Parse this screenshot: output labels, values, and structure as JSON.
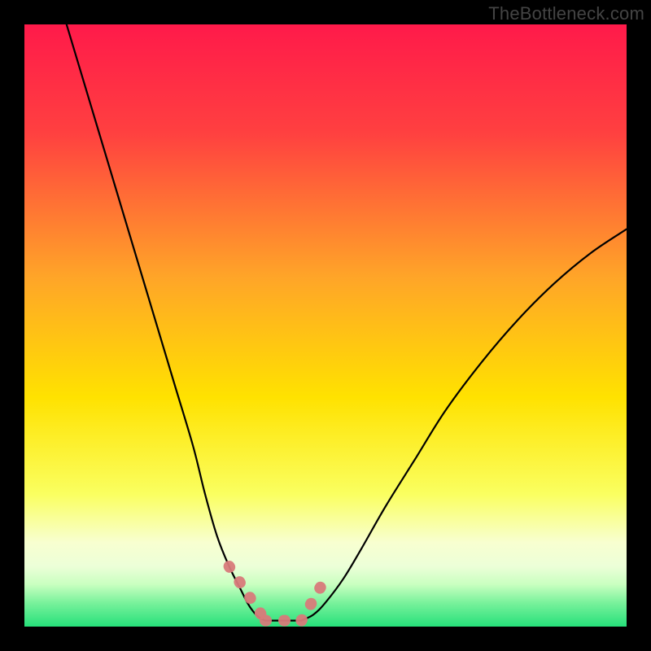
{
  "watermark": "TheBottleneck.com",
  "chart_data": {
    "type": "line",
    "title": "",
    "xlabel": "",
    "ylabel": "",
    "xlim": [
      0,
      100
    ],
    "ylim": [
      0,
      100
    ],
    "background_gradient": {
      "top_color": "#ff1a4a",
      "mid_color": "#ffe200",
      "bottom_band_color": "#f8ffd0",
      "base_color": "#26e07a"
    },
    "series": [
      {
        "name": "left-curve",
        "stroke": "#000000",
        "x": [
          7,
          10,
          13,
          16,
          19,
          22,
          25,
          28,
          30,
          32,
          34,
          36,
          37,
          38,
          39,
          40
        ],
        "y": [
          100,
          90,
          80,
          70,
          60,
          50,
          40,
          30,
          22,
          15,
          10,
          6,
          4,
          2.5,
          1.5,
          1
        ]
      },
      {
        "name": "right-curve",
        "stroke": "#000000",
        "x": [
          46,
          48,
          50,
          53,
          56,
          60,
          65,
          70,
          76,
          82,
          88,
          94,
          100
        ],
        "y": [
          1,
          2,
          4,
          8,
          13,
          20,
          28,
          36,
          44,
          51,
          57,
          62,
          66
        ]
      },
      {
        "name": "floor-segment",
        "stroke": "#000000",
        "x": [
          40,
          46
        ],
        "y": [
          1,
          1
        ]
      }
    ],
    "highlight_band": {
      "name": "optimal-range",
      "stroke": "#d87a7a",
      "segments": [
        {
          "x": [
            34,
            40
          ],
          "y": [
            10,
            1
          ]
        },
        {
          "x": [
            40,
            46
          ],
          "y": [
            1,
            1
          ]
        },
        {
          "x": [
            46,
            50
          ],
          "y": [
            1,
            8
          ]
        }
      ]
    }
  }
}
